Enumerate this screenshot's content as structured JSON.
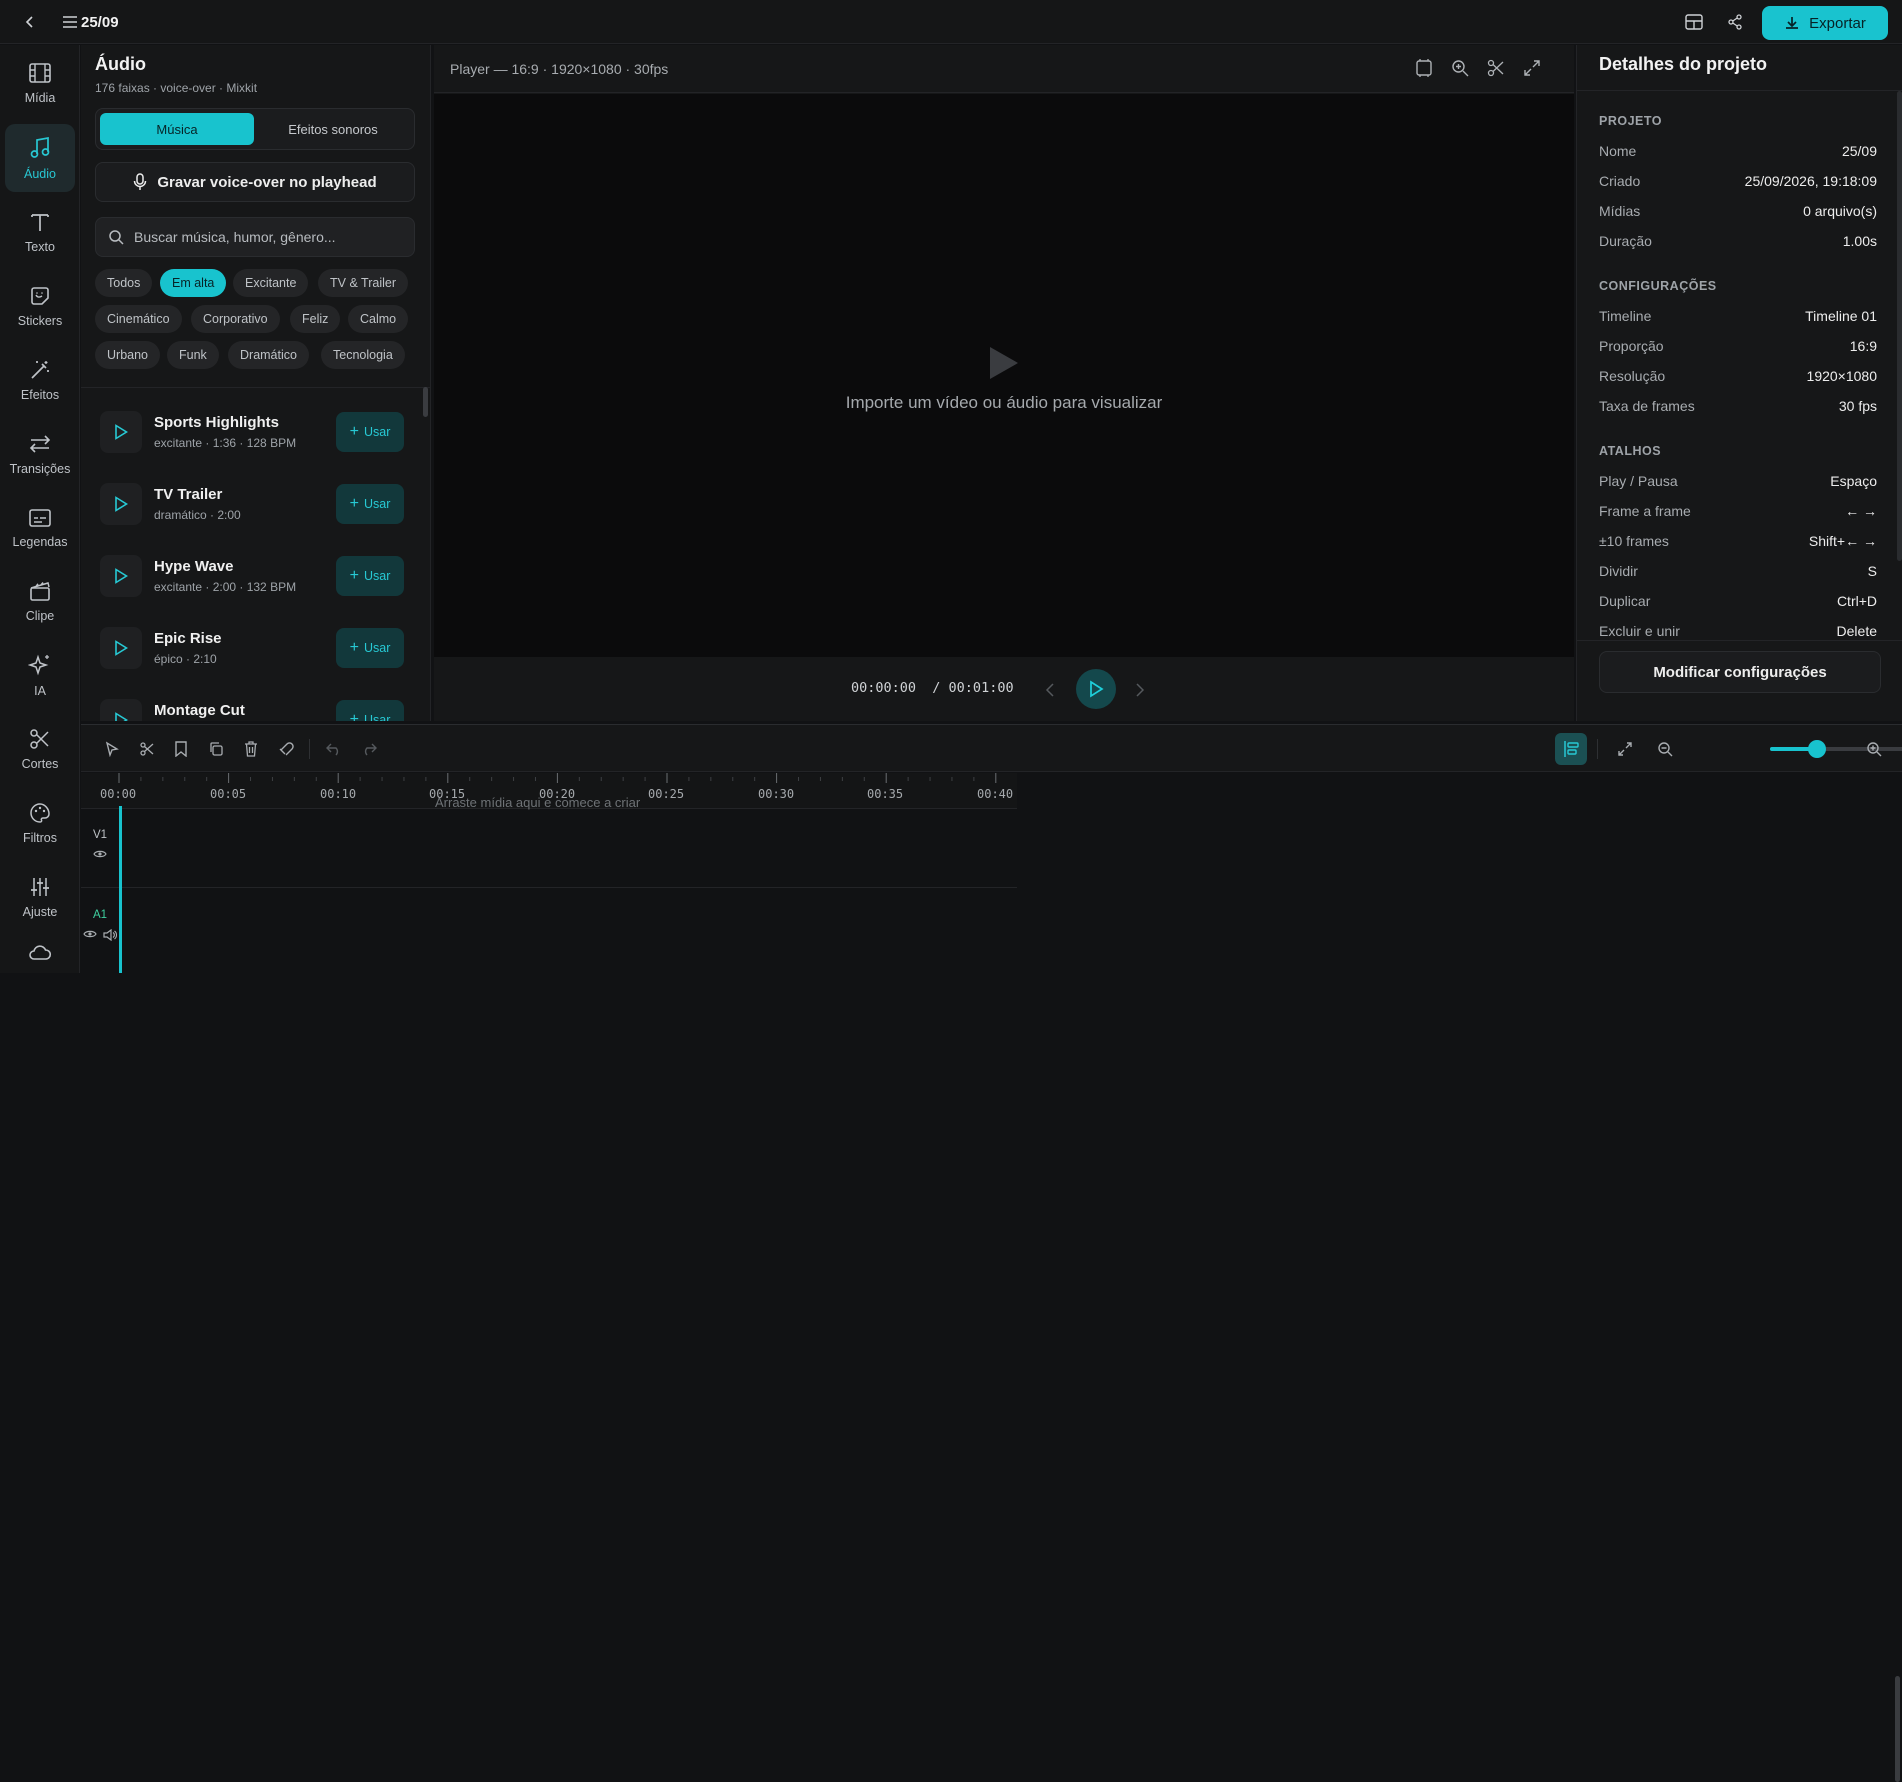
{
  "topbar": {
    "project_title": "25/09",
    "export_label": "Exportar"
  },
  "rail": [
    {
      "label": "Mídia",
      "icon": "film-icon"
    },
    {
      "label": "Áudio",
      "icon": "music-note-icon",
      "active": true
    },
    {
      "label": "Texto",
      "icon": "text-icon"
    },
    {
      "label": "Stickers",
      "icon": "sticker-icon"
    },
    {
      "label": "Efeitos",
      "icon": "magic-wand-icon"
    },
    {
      "label": "Transições",
      "icon": "transition-arrows-icon"
    },
    {
      "label": "Legendas",
      "icon": "subtitles-icon"
    },
    {
      "label": "Clipe",
      "icon": "clapperboard-icon"
    },
    {
      "label": "IA",
      "icon": "sparkle-icon"
    },
    {
      "label": "Cortes",
      "icon": "scissors-icon"
    },
    {
      "label": "Filtros",
      "icon": "palette-icon"
    },
    {
      "label": "Ajuste",
      "icon": "sliders-icon"
    },
    {
      "label": "",
      "icon": "cloud-icon"
    }
  ],
  "audio_panel": {
    "title": "Áudio",
    "subtitle": "176 faixas · voice-over · Mixkit",
    "tabs": [
      "Música",
      "Efeitos sonoros"
    ],
    "active_tab": 0,
    "record_label": "Gravar voice-over no playhead",
    "search_placeholder": "Buscar música, humor, gênero...",
    "chips": [
      "Todos",
      "Em alta",
      "Excitante",
      "TV & Trailer",
      "Cinemático",
      "Corporativo",
      "Feliz",
      "Calmo",
      "Urbano",
      "Funk",
      "Dramático",
      "Tecnologia"
    ],
    "active_chip": 1,
    "use_label": "Usar",
    "tracks": [
      {
        "name": "Sports Highlights",
        "meta": "excitante · 1:36 · 128 BPM"
      },
      {
        "name": "TV Trailer",
        "meta": "dramático · 2:00"
      },
      {
        "name": "Hype Wave",
        "meta": "excitante · 2:00 · 132 BPM"
      },
      {
        "name": "Epic Rise",
        "meta": "épico · 2:10"
      },
      {
        "name": "Montage Cut",
        "meta": ""
      }
    ]
  },
  "player": {
    "header": "Player — 16:9 · 1920×1080 · 30fps",
    "empty_hint": "Importe um vídeo ou áudio para visualizar",
    "current_time": "00:00:00",
    "total_time": "/ 00:01:00"
  },
  "details": {
    "title": "Detalhes do projeto",
    "sections": [
      {
        "heading": "PROJETO",
        "rows": [
          [
            "Nome",
            "25/09"
          ],
          [
            "Criado",
            "25/09/2026, 19:18:09"
          ],
          [
            "Mídias",
            "0 arquivo(s)"
          ],
          [
            "Duração",
            "1.00s"
          ]
        ]
      },
      {
        "heading": "CONFIGURAÇÕES",
        "rows": [
          [
            "Timeline",
            "Timeline 01"
          ],
          [
            "Proporção",
            "16:9"
          ],
          [
            "Resolução",
            "1920×1080"
          ],
          [
            "Taxa de frames",
            "30 fps"
          ]
        ]
      },
      {
        "heading": "ATALHOS",
        "rows": [
          [
            "Play / Pausa",
            "Espaço"
          ],
          [
            "Frame a frame",
            "← →"
          ],
          [
            "±10 frames",
            "Shift+← →"
          ],
          [
            "Dividir",
            "S"
          ],
          [
            "Duplicar",
            "Ctrl+D"
          ],
          [
            "Excluir e unir",
            "Delete"
          ]
        ]
      }
    ],
    "modify_label": "Modificar configurações"
  },
  "timeline": {
    "ticks": [
      "00:00",
      "00:05",
      "00:10",
      "00:15",
      "00:20",
      "00:25",
      "00:30",
      "00:35",
      "00:40"
    ],
    "drop_hint": "Arraste mídia aqui e comece a criar",
    "tracks": [
      "V1",
      "A1"
    ],
    "zoom_level": 0.3
  },
  "colors": {
    "accent": "#18c3ce",
    "background": "#111214",
    "panel": "#161718"
  }
}
